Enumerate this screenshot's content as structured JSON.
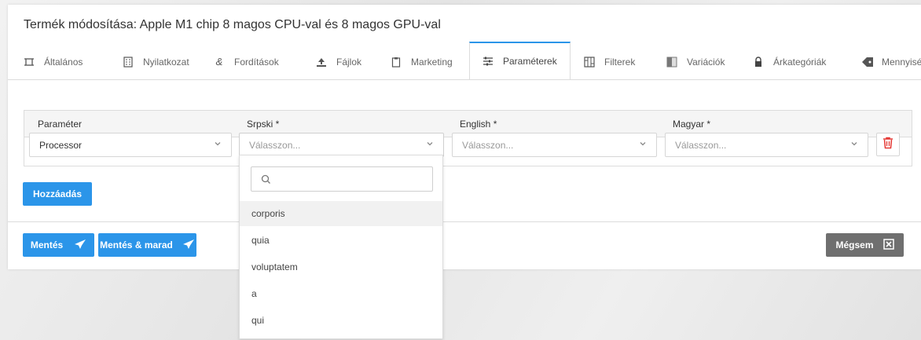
{
  "page": {
    "title": "Termék módosítása: Apple M1 chip 8 magos CPU-val és 8 magos GPU-val"
  },
  "tabs": [
    {
      "label": "Általános",
      "icon": "frame-icon"
    },
    {
      "label": "Nyilatkozat",
      "icon": "document-icon"
    },
    {
      "label": "Fordítások",
      "icon": "translate-icon"
    },
    {
      "label": "Fájlok",
      "icon": "upload-icon"
    },
    {
      "label": "Marketing",
      "icon": "clipboard-icon"
    },
    {
      "label": "Paraméterek",
      "icon": "sliders-icon",
      "active": true
    },
    {
      "label": "Filterek",
      "icon": "grid-icon"
    },
    {
      "label": "Variációk",
      "icon": "half-square-icon"
    },
    {
      "label": "Árkategóriák",
      "icon": "lock-icon"
    },
    {
      "label": "Mennyisé",
      "icon": "tag-icon"
    }
  ],
  "table": {
    "headers": [
      "Paraméter",
      "Srpski *",
      "English *",
      "Magyar *"
    ],
    "row": {
      "parameter": "Processor",
      "srpski_placeholder": "Válasszon...",
      "english_placeholder": "Válasszon...",
      "magyar_placeholder": "Válasszon..."
    }
  },
  "dropdown": {
    "search_value": "",
    "options": [
      "corporis",
      "quia",
      "voluptatem",
      "a",
      "qui"
    ],
    "highlighted": "corporis"
  },
  "buttons": {
    "add": "Hozzáadás",
    "save": "Mentés",
    "save_stay": "Mentés & marad",
    "cancel": "Mégsem"
  },
  "colors": {
    "accent": "#2b95e9",
    "danger": "#e53935",
    "cancel": "#6f6f6f"
  }
}
